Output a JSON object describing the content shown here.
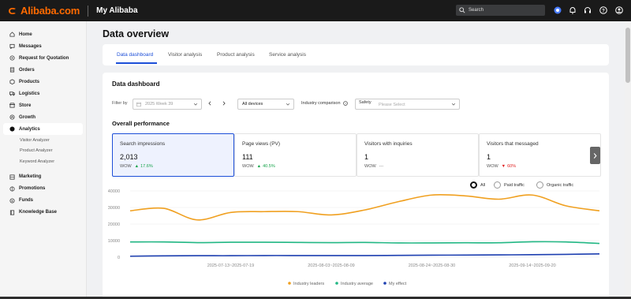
{
  "topbar": {
    "brand": "Alibaba.com",
    "title": "My Alibaba",
    "search_placeholder": "Search",
    "icons": [
      "globe-icon",
      "bell-icon",
      "headset-icon",
      "help-icon",
      "user-icon"
    ]
  },
  "sidebar": {
    "items": [
      {
        "label": "Home",
        "icon": "home-icon"
      },
      {
        "label": "Messages",
        "icon": "message-icon"
      },
      {
        "label": "Request for Quotation",
        "icon": "rfq-icon"
      },
      {
        "label": "Orders",
        "icon": "orders-icon"
      },
      {
        "label": "Products",
        "icon": "products-icon"
      },
      {
        "label": "Logistics",
        "icon": "logistics-icon"
      },
      {
        "label": "Store",
        "icon": "store-icon"
      },
      {
        "label": "Growth",
        "icon": "growth-icon"
      },
      {
        "label": "Analytics",
        "icon": "analytics-icon"
      }
    ],
    "sub_items": [
      "Visitor Analyzer",
      "Product Analyzer",
      "Keyword Analyzer"
    ],
    "items_after": [
      {
        "label": "Marketing",
        "icon": "marketing-icon"
      },
      {
        "label": "Promotions",
        "icon": "promotions-icon"
      },
      {
        "label": "Funds",
        "icon": "funds-icon"
      },
      {
        "label": "Knowledge Base",
        "icon": "knowledge-icon"
      }
    ]
  },
  "main": {
    "page_title": "Data overview",
    "tabs": [
      "Data dashboard",
      "Visitor analysis",
      "Product analysis",
      "Service analysis"
    ],
    "dashboard_title": "Data dashboard",
    "filter_label": "Filter by",
    "week_value": "2025 Week 39",
    "device_value": "All devices",
    "industry_label": "Industry comparison",
    "safety_label": "Safety",
    "safety_placeholder": "Please Select",
    "overall_title": "Overall performance",
    "metrics": [
      {
        "title": "Search impressions",
        "value": "2,013",
        "wow_label": "WOW",
        "change": "17.6%",
        "direction": "up"
      },
      {
        "title": "Page views (PV)",
        "value": "111",
        "wow_label": "WOW",
        "change": "40.5%",
        "direction": "up"
      },
      {
        "title": "Visitors with inquiries",
        "value": "1",
        "wow_label": "WOW",
        "change": "---",
        "direction": "none"
      },
      {
        "title": "Visitors that messaged",
        "value": "1",
        "wow_label": "WOW",
        "change": "60%",
        "direction": "down"
      }
    ],
    "traffic_options": [
      "All",
      "Paid traffic",
      "Organic traffic"
    ],
    "traffic_selected": "All"
  },
  "chart_data": {
    "type": "line",
    "y_ticks": [
      "40000",
      "30000",
      "20000",
      "10000",
      "0"
    ],
    "ylim": [
      0,
      40000
    ],
    "x_tick_labels": [
      "2025-07-13~2025-07-19",
      "2025-08-03~2025-08-09",
      "2025-08-24~2025-08-30",
      "2025-09-14~2025-09-20"
    ],
    "x_tick_positions": [
      3,
      6,
      9,
      12
    ],
    "num_points": 15,
    "series": [
      {
        "name": "Industry leaders",
        "color": "#f0a020",
        "values": [
          28000,
          29500,
          22500,
          27000,
          27500,
          27500,
          25500,
          28500,
          33500,
          37500,
          37000,
          35000,
          37500,
          31000,
          28000
        ]
      },
      {
        "name": "Industry average",
        "color": "#22b784",
        "values": [
          9200,
          9200,
          8800,
          9000,
          9000,
          8900,
          8800,
          8900,
          8600,
          8600,
          8700,
          8700,
          9300,
          9200,
          8300
        ]
      },
      {
        "name": "My effect",
        "color": "#1d3fb0",
        "values": [
          600,
          800,
          900,
          900,
          1000,
          1000,
          1000,
          1000,
          1100,
          1200,
          1300,
          1400,
          1500,
          1700,
          2000
        ]
      }
    ],
    "legend_position": "bottom",
    "grid": true
  }
}
